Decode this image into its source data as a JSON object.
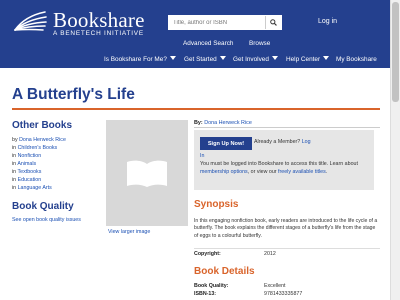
{
  "header": {
    "logo_name": "Bookshare",
    "logo_tagline": "A BENETECH INITIATIVE",
    "search_placeholder": "Title, author or ISBN",
    "login": "Log in",
    "subnav": [
      "Advanced Search",
      "Browse"
    ],
    "mainnav": [
      "Is Bookshare For Me?",
      "Get Started",
      "Get Involved",
      "Help Center",
      "My Bookshare"
    ],
    "colors": {
      "header_bg": "#24408e",
      "accent": "#d9642b"
    }
  },
  "book": {
    "title": "A Butterfly's Life",
    "by_label": "By:",
    "author": "Dona Herweck Rice",
    "view_larger": "View larger image"
  },
  "other_books": {
    "heading": "Other Books",
    "items": [
      {
        "prefix": "by ",
        "link": "Dona Herweck Rice"
      },
      {
        "prefix": "in ",
        "link": "Children's Books"
      },
      {
        "prefix": "in ",
        "link": "Nonfiction"
      },
      {
        "prefix": "in ",
        "link": "Animals"
      },
      {
        "prefix": "in ",
        "link": "Textbooks"
      },
      {
        "prefix": "in ",
        "link": "Education"
      },
      {
        "prefix": "in ",
        "link": "Language Arts"
      }
    ]
  },
  "book_quality": {
    "heading": "Book Quality",
    "link": "See open book quality issues"
  },
  "signup": {
    "button": "Sign Up Now!",
    "already": "Already a Member?",
    "log_part1": "Log",
    "log_part2": "In",
    "must_text": "You must be logged into Bookshare to access this title. Learn about",
    "membership": "membership options",
    "or_view": ", or view our",
    "freely": "freely available titles",
    "period": "."
  },
  "synopsis": {
    "heading": "Synopsis",
    "text": "In this engaging nonfiction book, early readers are introduced to the life cycle of a butterfly. The book explains the different stages of a butterfly's life from the stage of eggs to a colourful butterfly."
  },
  "meta": {
    "copyright_label": "Copyright:",
    "copyright_value": "2012"
  },
  "details": {
    "heading": "Book Details",
    "quality_label": "Book Quality:",
    "quality_value": "Excellent",
    "isbn_label": "ISBN-13:",
    "isbn_value": "9781433335877"
  }
}
